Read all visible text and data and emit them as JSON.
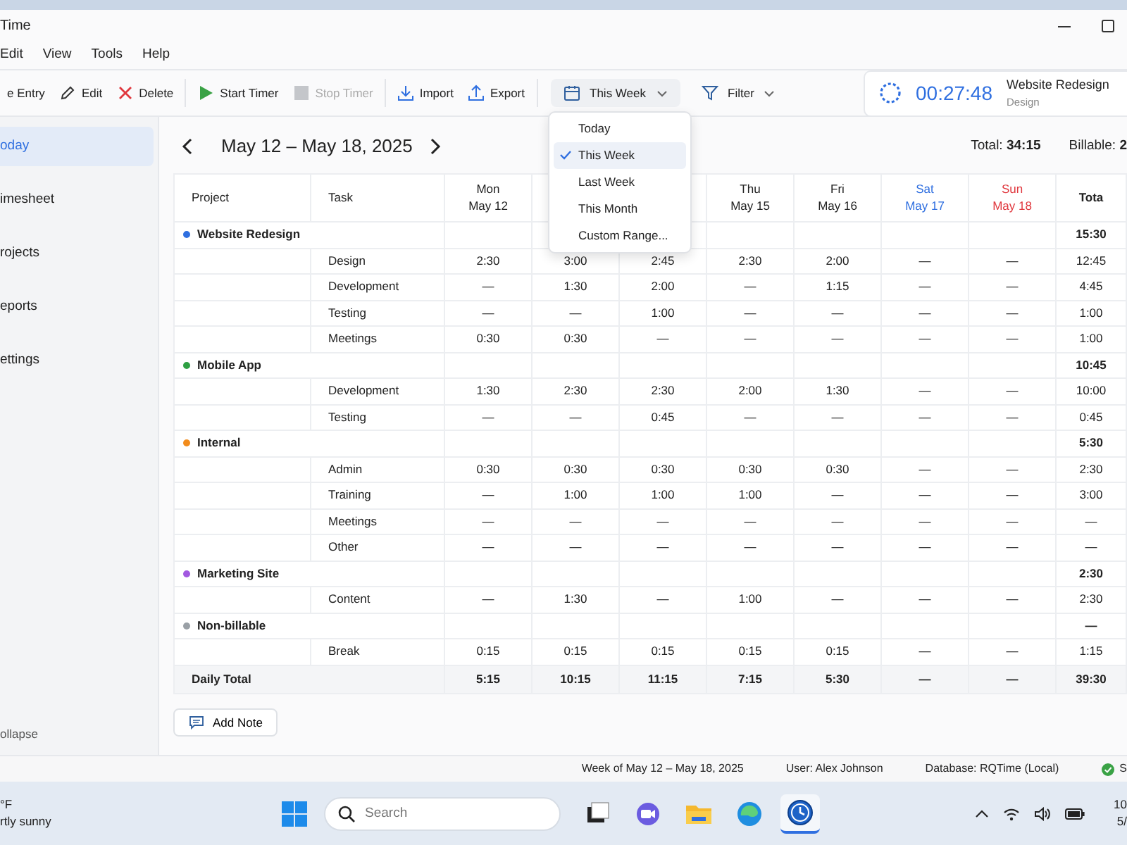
{
  "window": {
    "title": "Time"
  },
  "menu": [
    "Edit",
    "View",
    "Tools",
    "Help"
  ],
  "toolbar": [
    {
      "kind": "button",
      "label": "e Entry",
      "disabled": false
    },
    {
      "kind": "button",
      "label": "Edit",
      "disabled": false
    },
    {
      "kind": "button",
      "label": "Delete",
      "disabled": false
    },
    {
      "kind": "separator"
    },
    {
      "kind": "button",
      "label": "Start Timer",
      "disabled": false
    },
    {
      "kind": "button",
      "label": "Stop Timer",
      "disabled": true
    },
    {
      "kind": "separator"
    },
    {
      "kind": "button",
      "label": "Import",
      "disabled": false
    },
    {
      "kind": "button",
      "label": "Export",
      "disabled": false
    },
    {
      "kind": "separator"
    },
    {
      "kind": "dropdown",
      "label": "This Week",
      "expanded": true,
      "options": [
        {
          "label": "Today",
          "selected": false
        },
        {
          "label": "This Week",
          "selected": true
        },
        {
          "label": "Last Week",
          "selected": false
        },
        {
          "label": "This Month",
          "selected": false
        },
        {
          "label": "Custom Range...",
          "selected": false
        }
      ]
    },
    {
      "kind": "dropdown",
      "label": "Filter",
      "expanded": false
    }
  ],
  "timer": {
    "elapsed": "00:27:48",
    "project": "Website Redesign",
    "task": "Design"
  },
  "sidebar": {
    "items": [
      {
        "label": "oday",
        "selected": true
      },
      {
        "label": "imesheet",
        "selected": false
      },
      {
        "label": "rojects",
        "selected": false
      },
      {
        "label": "eports",
        "selected": false
      },
      {
        "label": "ettings",
        "selected": false
      }
    ],
    "collapse": "ollapse"
  },
  "week_nav": {
    "range": "May 12 – May 18, 2025",
    "total_label": "Total:",
    "total": "34:15",
    "billable_label": "Billable:",
    "billable": "2"
  },
  "table": {
    "columns": [
      {
        "kind": "text",
        "label": "Project"
      },
      {
        "kind": "text",
        "label": "Task"
      },
      {
        "kind": "weekday",
        "day": "Mon",
        "date": "May 12"
      },
      {
        "kind": "covered"
      },
      {
        "kind": "covered"
      },
      {
        "kind": "weekday",
        "day": "Thu",
        "date": "May 15"
      },
      {
        "kind": "weekday",
        "day": "Fri",
        "date": "May 16"
      },
      {
        "kind": "saturday",
        "day": "Sat",
        "date": "May 17"
      },
      {
        "kind": "sunday",
        "day": "Sun",
        "date": "May 18"
      },
      {
        "kind": "text",
        "label": "Tota"
      }
    ],
    "rows": [
      {
        "kind": "project",
        "name": "Website Redesign",
        "color": "#2f6fe0",
        "total": "15:30"
      },
      {
        "kind": "task",
        "task": "Design",
        "values": [
          "2:30",
          "3:00",
          "2:45",
          "2:30",
          "2:00",
          "—",
          "—"
        ],
        "total": "12:45"
      },
      {
        "kind": "task",
        "task": "Development",
        "values": [
          "—",
          "1:30",
          "2:00",
          "—",
          "1:15",
          "—",
          "—"
        ],
        "total": "4:45"
      },
      {
        "kind": "task",
        "task": "Testing",
        "values": [
          "—",
          "—",
          "1:00",
          "—",
          "—",
          "—",
          "—"
        ],
        "total": "1:00"
      },
      {
        "kind": "task",
        "task": "Meetings",
        "values": [
          "0:30",
          "0:30",
          "—",
          "—",
          "—",
          "—",
          "—"
        ],
        "total": "1:00"
      },
      {
        "kind": "project",
        "name": "Mobile App",
        "color": "#2ea043",
        "total": "10:45"
      },
      {
        "kind": "task",
        "task": "Development",
        "values": [
          "1:30",
          "2:30",
          "2:30",
          "2:00",
          "1:30",
          "—",
          "—"
        ],
        "total": "10:00"
      },
      {
        "kind": "task",
        "task": "Testing",
        "values": [
          "—",
          "—",
          "0:45",
          "—",
          "—",
          "—",
          "—"
        ],
        "total": "0:45"
      },
      {
        "kind": "project",
        "name": "Internal",
        "color": "#f28c1c",
        "total": "5:30"
      },
      {
        "kind": "task",
        "task": "Admin",
        "values": [
          "0:30",
          "0:30",
          "0:30",
          "0:30",
          "0:30",
          "—",
          "—"
        ],
        "total": "2:30"
      },
      {
        "kind": "task",
        "task": "Training",
        "values": [
          "—",
          "1:00",
          "1:00",
          "1:00",
          "—",
          "—",
          "—"
        ],
        "total": "3:00"
      },
      {
        "kind": "task",
        "task": "Meetings",
        "values": [
          "—",
          "—",
          "—",
          "—",
          "—",
          "—",
          "—"
        ],
        "total": "—"
      },
      {
        "kind": "task",
        "task": "Other",
        "values": [
          "—",
          "—",
          "—",
          "—",
          "—",
          "—",
          "—"
        ],
        "total": "—"
      },
      {
        "kind": "project",
        "name": "Marketing Site",
        "color": "#a259e0",
        "total": "2:30"
      },
      {
        "kind": "task",
        "task": "Content",
        "values": [
          "—",
          "1:30",
          "—",
          "1:00",
          "—",
          "—",
          "—"
        ],
        "total": "2:30"
      },
      {
        "kind": "project",
        "name": "Non-billable",
        "color": "#9aa0a6",
        "total": "—"
      },
      {
        "kind": "task",
        "task": "Break",
        "values": [
          "0:15",
          "0:15",
          "0:15",
          "0:15",
          "0:15",
          "—",
          "—"
        ],
        "total": "1:15"
      },
      {
        "kind": "summary",
        "label": "Daily Total",
        "values": [
          "5:15",
          "10:15",
          "11:15",
          "7:15",
          "5:30",
          "—",
          "—"
        ],
        "total": "39:30"
      }
    ]
  },
  "add_note": "Add Note",
  "status_bar": {
    "items": [
      "Week of May 12 – May 18, 2025",
      "User: Alex Johnson",
      "Database: RQTime (Local)"
    ],
    "connection": "S"
  },
  "taskbar": {
    "weather": {
      "temp": "°F",
      "condition": "rtly sunny"
    },
    "search_placeholder": "Search",
    "apps": [
      {
        "selected": false
      },
      {
        "selected": false
      },
      {
        "selected": false
      },
      {
        "selected": false
      },
      {
        "selected": true
      }
    ],
    "clock": {
      "time": "10",
      "date": "5/"
    }
  }
}
